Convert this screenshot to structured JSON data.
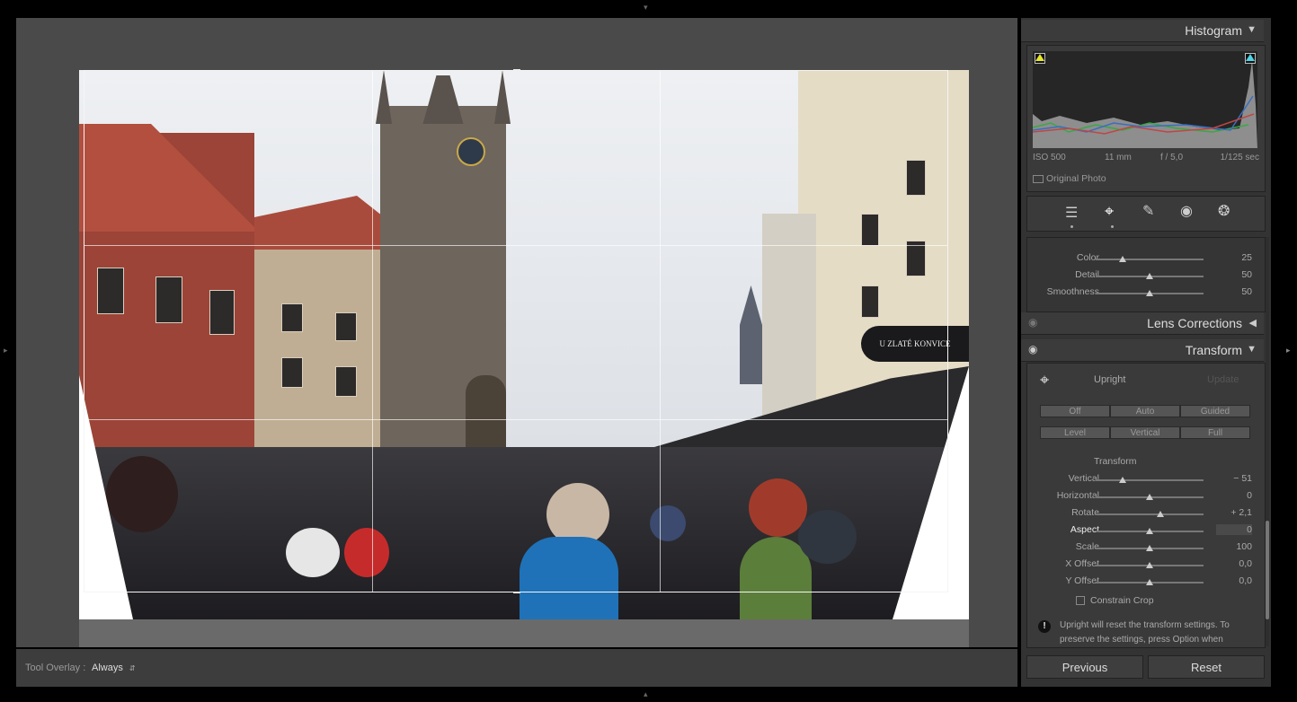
{
  "histogram": {
    "title": "Histogram",
    "iso": "ISO 500",
    "focal": "11 mm",
    "aperture": "f / 5,0",
    "shutter": "1/125 sec",
    "original_photo_label": "Original Photo"
  },
  "tools": [
    "sliders-icon",
    "crop-icon",
    "healing-icon",
    "redeye-icon",
    "radial-filter-icon"
  ],
  "noise": {
    "rows": [
      {
        "label": "Color",
        "value": "25",
        "pos": 0.25
      },
      {
        "label": "Detail",
        "value": "50",
        "pos": 0.5
      },
      {
        "label": "Smoothness",
        "value": "50",
        "pos": 0.5
      }
    ]
  },
  "lens_corrections": {
    "title": "Lens Corrections"
  },
  "transform": {
    "title": "Transform",
    "upright_label": "Upright",
    "update_label": "Update",
    "row1": [
      "Off",
      "Auto",
      "Guided"
    ],
    "row2": [
      "Level",
      "Vertical",
      "Full"
    ],
    "section_label": "Transform",
    "sliders": [
      {
        "label": "Vertical",
        "value": "− 51",
        "pos": 0.25
      },
      {
        "label": "Horizontal",
        "value": "0",
        "pos": 0.5
      },
      {
        "label": "Rotate",
        "value": "+ 2,1",
        "pos": 0.6
      },
      {
        "label": "Aspect",
        "value": "0",
        "pos": 0.5
      },
      {
        "label": "Scale",
        "value": "100",
        "pos": 0.5
      },
      {
        "label": "X Offset",
        "value": "0,0",
        "pos": 0.5
      },
      {
        "label": "Y Offset",
        "value": "0,0",
        "pos": 0.5
      }
    ],
    "constrain_label": "Constrain Crop",
    "info_line1": "Upright will reset the transform settings. To",
    "info_line2": "preserve the settings, press Option when"
  },
  "buttons": {
    "previous": "Previous",
    "reset": "Reset"
  },
  "overlay": {
    "label": "Tool Overlay :",
    "value": "Always"
  },
  "photo": {
    "sign_text": "U ZLATÉ KONVICE"
  }
}
